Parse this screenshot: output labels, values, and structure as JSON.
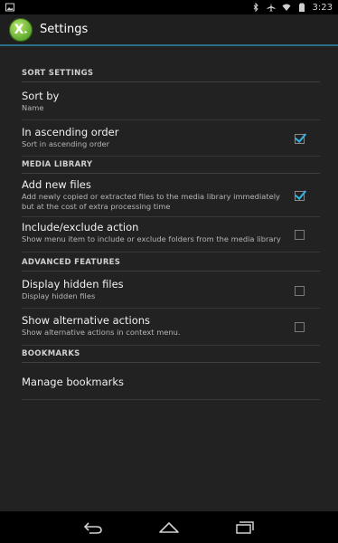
{
  "status_bar": {
    "time": "3:23",
    "left_icons": [
      "image-notification-icon"
    ],
    "right_icons": [
      "bluetooth-icon",
      "airplane-mode-icon",
      "wifi-icon",
      "battery-icon"
    ]
  },
  "action_bar": {
    "title": "Settings",
    "logo_text": "X"
  },
  "sections": {
    "sort": {
      "header": "SORT SETTINGS",
      "sort_by": {
        "title": "Sort by",
        "summary": "Name"
      },
      "ascending": {
        "title": "In ascending order",
        "summary": "Sort in ascending order",
        "checked": true
      }
    },
    "media": {
      "header": "MEDIA LIBRARY",
      "add_new": {
        "title": "Add new files",
        "summary": "Add newly copied or extracted files to the media library immediately but at the cost of extra processing time",
        "checked": true
      },
      "include_exclude": {
        "title": "Include/exclude action",
        "summary": "Show menu item to include or exclude folders from the media library",
        "checked": false
      }
    },
    "advanced": {
      "header": "ADVANCED FEATURES",
      "hidden": {
        "title": "Display hidden files",
        "summary": "Display hidden files",
        "checked": false
      },
      "alt_actions": {
        "title": "Show alternative actions",
        "summary": "Show alternative actions in context menu.",
        "checked": false
      }
    },
    "bookmarks": {
      "header": "BOOKMARKS",
      "manage": {
        "title": "Manage bookmarks"
      }
    }
  },
  "colors": {
    "accent": "#33b5e5",
    "actionbar_underline": "#2b6f86",
    "background": "#222222"
  },
  "nav_bar": {
    "buttons": [
      "back-icon",
      "home-icon",
      "recents-icon"
    ]
  }
}
